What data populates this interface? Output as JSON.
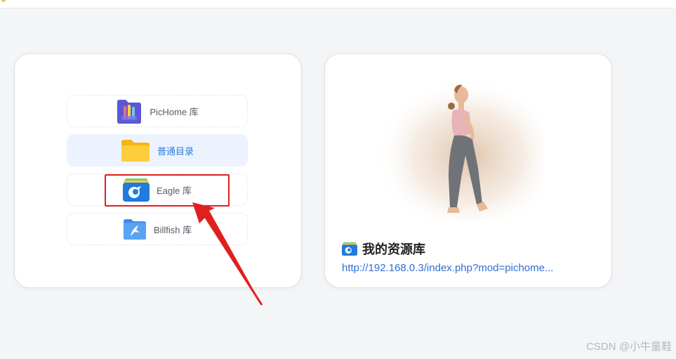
{
  "library_picker": {
    "options": [
      {
        "label": "PicHome 库",
        "icon": "pichome-icon",
        "selected": false
      },
      {
        "label": "普通目录",
        "icon": "folder-icon",
        "selected": true
      },
      {
        "label": "Eagle 库",
        "icon": "eagle-icon",
        "selected": false
      },
      {
        "label": "Billfish 库",
        "icon": "billfish-icon",
        "selected": false
      }
    ]
  },
  "resource_card": {
    "title": "我的资源库",
    "title_icon": "eagle-icon",
    "link": "http://192.168.0.3/index.php?mod=pichome..."
  },
  "watermark": "CSDN @小牛童鞋",
  "colors": {
    "accent_blue": "#2b7cdc",
    "selected_bg": "#ecf3fe",
    "annotation_red": "#e02020",
    "link": "#2f6fd6"
  }
}
